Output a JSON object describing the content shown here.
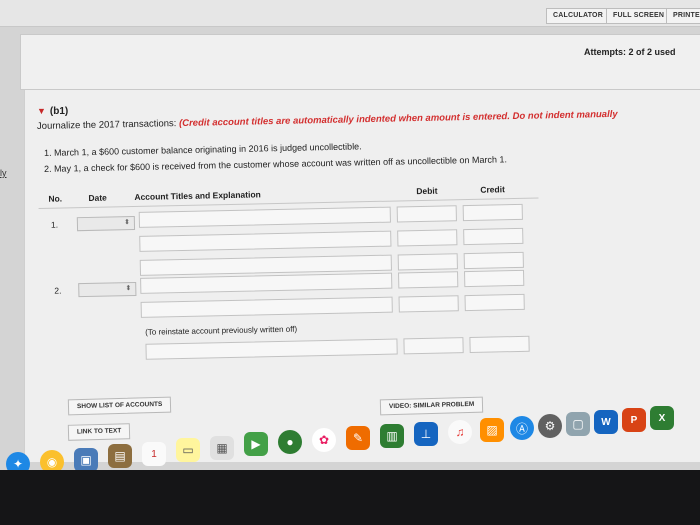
{
  "topbar": {
    "calculator": "CALCULATOR",
    "fullscreen": "FULL SCREEN",
    "print": "PRINTE"
  },
  "attempts": "Attempts: 2 of 2 used",
  "section": {
    "title": "(b1)",
    "instruction": "Journalize the 2017 transactions:",
    "note": "(Credit account titles are automatically indented when amount is entered. Do not indent manually",
    "transactions": [
      "1.  March 1, a $600 customer balance originating in 2016 is judged uncollectible.",
      "2.  May 1, a check for $600 is received from the customer whose account was written off as uncollectible on March 1."
    ]
  },
  "side_link": "ly",
  "table": {
    "headers": {
      "no": "No.",
      "date": "Date",
      "account": "Account Titles and Explanation",
      "debit": "Debit",
      "credit": "Credit"
    },
    "rows": [
      {
        "no": "1.",
        "date_value": "",
        "select_arrow": "⬍"
      },
      {
        "no": "2.",
        "date_value": "",
        "select_arrow": "⬍"
      }
    ],
    "memo": "(To reinstate account previously written off)"
  },
  "buttons": {
    "show_accounts": "SHOW LIST OF ACCOUNTS",
    "link_text": "LINK TO TEXT",
    "video": "VIDEO: SIMILAR PROBLEM"
  },
  "dock_icons": [
    "safari-icon",
    "chrome-icon",
    "preview-icon",
    "notebook-icon",
    "calendar-icon",
    "notes-icon",
    "photos-icon",
    "facetime-icon",
    "messages-icon",
    "photos-app-icon",
    "pages-icon",
    "numbers-icon",
    "keynote-icon",
    "music-icon",
    "books-icon",
    "appstore-icon",
    "settings-icon",
    "finder-window-icon",
    "word-icon",
    "powerpoint-icon",
    "excel-icon"
  ],
  "calendar_day": "1",
  "word_letter": "W",
  "ppt_letter": "P",
  "excel_letter": "X"
}
